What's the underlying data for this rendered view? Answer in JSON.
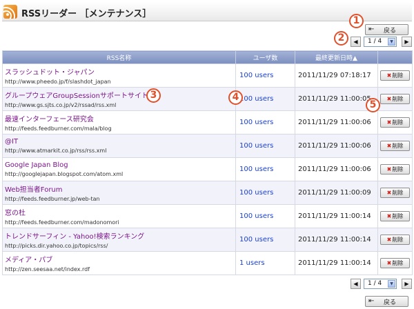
{
  "header": {
    "title": "RSSリーダー ［メンテナンス］"
  },
  "nav": {
    "back_label": "戻る"
  },
  "pager": {
    "prev_symbol": "◀",
    "next_symbol": "▶",
    "page_value": "1 / 4",
    "dropdown_symbol": "▼"
  },
  "badges": [
    "1",
    "2",
    "3",
    "4",
    "5"
  ],
  "table": {
    "headers": {
      "name": "RSS名称",
      "users": "ユーザ数",
      "updated": "最終更新日時▲",
      "action": ""
    },
    "delete_label": "削除",
    "delete_symbol": "✖",
    "rows": [
      {
        "name": "スラッシュドット・ジャパン",
        "url": "http://www.pheedo.jp/f/slashdot_japan",
        "users": "100 users",
        "updated": "2011/11/29 07:18:17"
      },
      {
        "name": "グループウェアGroupSessionサポートサイト",
        "url": "http://www.gs.sjts.co.jp/v2/rssad/rss.xml",
        "users": "100 users",
        "updated": "2011/11/29 11:00:05"
      },
      {
        "name": "最速インターフェース研究会",
        "url": "http://feeds.feedburner.com/mala/blog",
        "users": "100 users",
        "updated": "2011/11/29 11:00:06"
      },
      {
        "name": "@IT",
        "url": "http://www.atmarkit.co.jp/rss/rss.xml",
        "users": "100 users",
        "updated": "2011/11/29 11:00:06"
      },
      {
        "name": "Google Japan Blog",
        "url": "http://googlejapan.blogspot.com/atom.xml",
        "users": "100 users",
        "updated": "2011/11/29 11:00:06"
      },
      {
        "name": "Web担当者Forum",
        "url": "http://feeds.feedburner.jp/web-tan",
        "users": "100 users",
        "updated": "2011/11/29 11:00:09"
      },
      {
        "name": "窓の杜",
        "url": "http://feeds.feedburner.com/madonomori",
        "users": "100 users",
        "updated": "2011/11/29 11:00:14"
      },
      {
        "name": "トレンドサーフィン - Yahoo!検索ランキング",
        "url": "http://picks.dir.yahoo.co.jp/topics/rss/",
        "users": "100 users",
        "updated": "2011/11/29 11:00:14"
      },
      {
        "name": "メディア・パブ",
        "url": "http://zen.seesaa.net/index.rdf",
        "users": "1 users",
        "updated": "2011/11/29 11:00:14"
      }
    ]
  },
  "colors": {
    "header_bg": "#8a9bc8",
    "badge": "#e0502a",
    "link": "#1a3fd0",
    "feed_name": "#7a168a",
    "delete_x": "#d0201a"
  }
}
